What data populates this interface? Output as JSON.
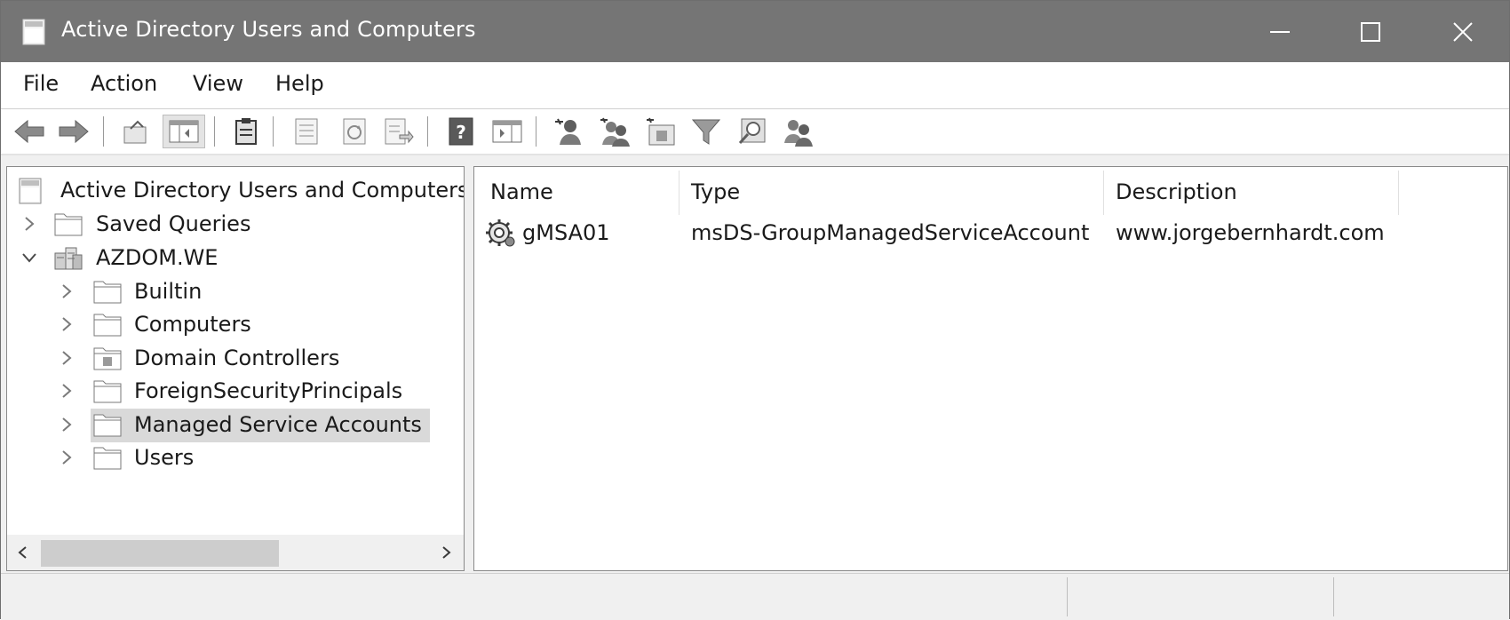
{
  "window": {
    "title": "Active Directory Users and Computers",
    "icon": "mmc-console-icon"
  },
  "menu": [
    "File",
    "Action",
    "View",
    "Help"
  ],
  "toolbar": {
    "buttons": [
      "back-arrow-icon",
      "forward-arrow-icon",
      "up-folder-icon",
      "show-hide-tree-icon",
      "paste-icon",
      "properties-icon",
      "refresh-icon",
      "export-list-icon",
      "help-icon",
      "show-action-pane-icon",
      "new-user-icon",
      "new-group-icon",
      "new-ou-icon",
      "filter-icon",
      "find-icon",
      "add-to-group-icon"
    ]
  },
  "tree": {
    "root": "Active Directory Users and Computers",
    "items": [
      {
        "label": "Saved Queries",
        "expanded": false
      },
      {
        "label": "AZDOM.WE",
        "expanded": true
      },
      {
        "label": "Builtin"
      },
      {
        "label": "Computers"
      },
      {
        "label": "Domain Controllers"
      },
      {
        "label": "ForeignSecurityPrincipals"
      },
      {
        "label": "Managed Service Accounts",
        "selected": true
      },
      {
        "label": "Users"
      }
    ]
  },
  "list": {
    "columns": [
      "Name",
      "Type",
      "Description"
    ],
    "rows": [
      {
        "name": "gMSA01",
        "type": "msDS-GroupManagedServiceAccount",
        "description": "www.jorgebernhardt.com"
      }
    ]
  },
  "colors": {
    "titlebar": "#757575",
    "selection": "#d9d9d9"
  }
}
